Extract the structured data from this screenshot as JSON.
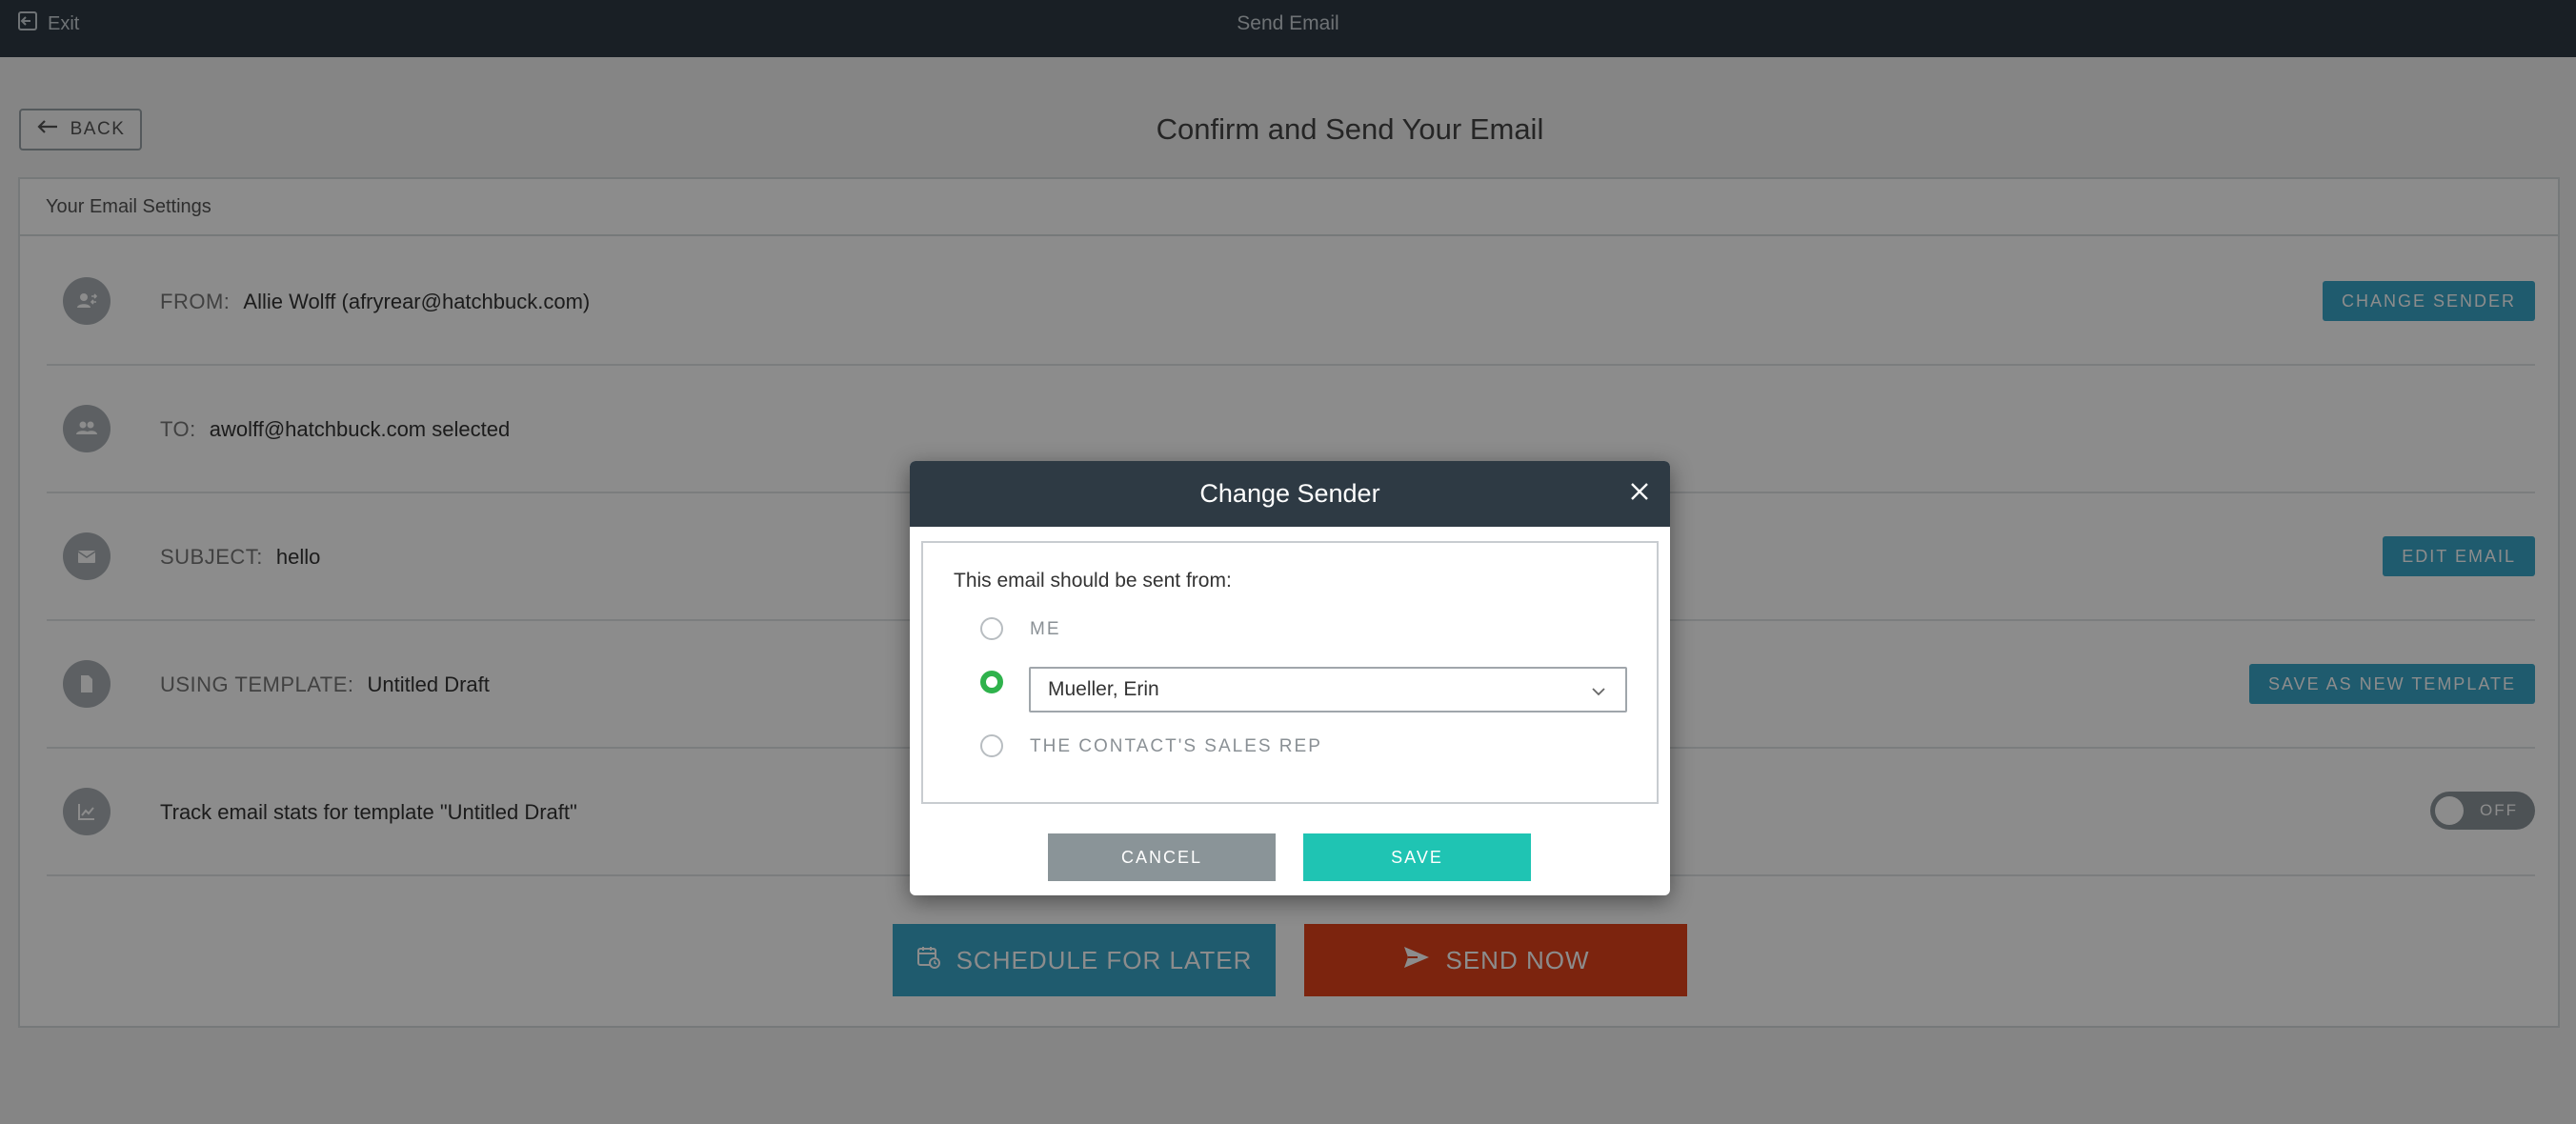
{
  "topbar": {
    "exit_label": "Exit",
    "title": "Send Email"
  },
  "page": {
    "back_label": "BACK",
    "title": "Confirm and Send Your Email"
  },
  "settings": {
    "header": "Your Email Settings",
    "from": {
      "label": "FROM:",
      "value": "Allie Wolff (afryrear@hatchbuck.com)",
      "action": "CHANGE SENDER"
    },
    "to": {
      "label": "TO:",
      "value": "awolff@hatchbuck.com selected"
    },
    "subject": {
      "label": "SUBJECT:",
      "value": "hello",
      "action": "EDIT EMAIL"
    },
    "template": {
      "label": "USING TEMPLATE:",
      "value": "Untitled Draft",
      "action": "SAVE AS NEW TEMPLATE"
    },
    "track": {
      "text": "Track email stats for template \"Untitled Draft\"",
      "toggle_label": "OFF",
      "toggle_on": false
    }
  },
  "actions": {
    "schedule_label": "SCHEDULE FOR LATER",
    "send_label": "SEND NOW"
  },
  "modal": {
    "title": "Change Sender",
    "prompt": "This email should be sent from:",
    "options": [
      {
        "label": "ME",
        "selected": false
      },
      {
        "label": "Mueller, Erin",
        "selected": true
      },
      {
        "label": "THE CONTACT'S SALES REP",
        "selected": false
      }
    ],
    "cancel_label": "CANCEL",
    "save_label": "SAVE"
  },
  "colors": {
    "topbar": "#2e3a44",
    "accent_blue": "#3aa6c9",
    "send_red": "#e2421a",
    "save_teal": "#1fc4b3",
    "radio_green": "#2fb24c"
  },
  "icons": {
    "exit": "exit-icon",
    "back": "arrow-left-icon",
    "from": "user-swap-icon",
    "to": "users-icon",
    "subject": "envelope-icon",
    "template": "document-icon",
    "track": "chart-icon",
    "schedule": "calendar-clock-icon",
    "send": "paper-plane-icon",
    "close": "close-icon",
    "chevron": "chevron-down-icon"
  }
}
